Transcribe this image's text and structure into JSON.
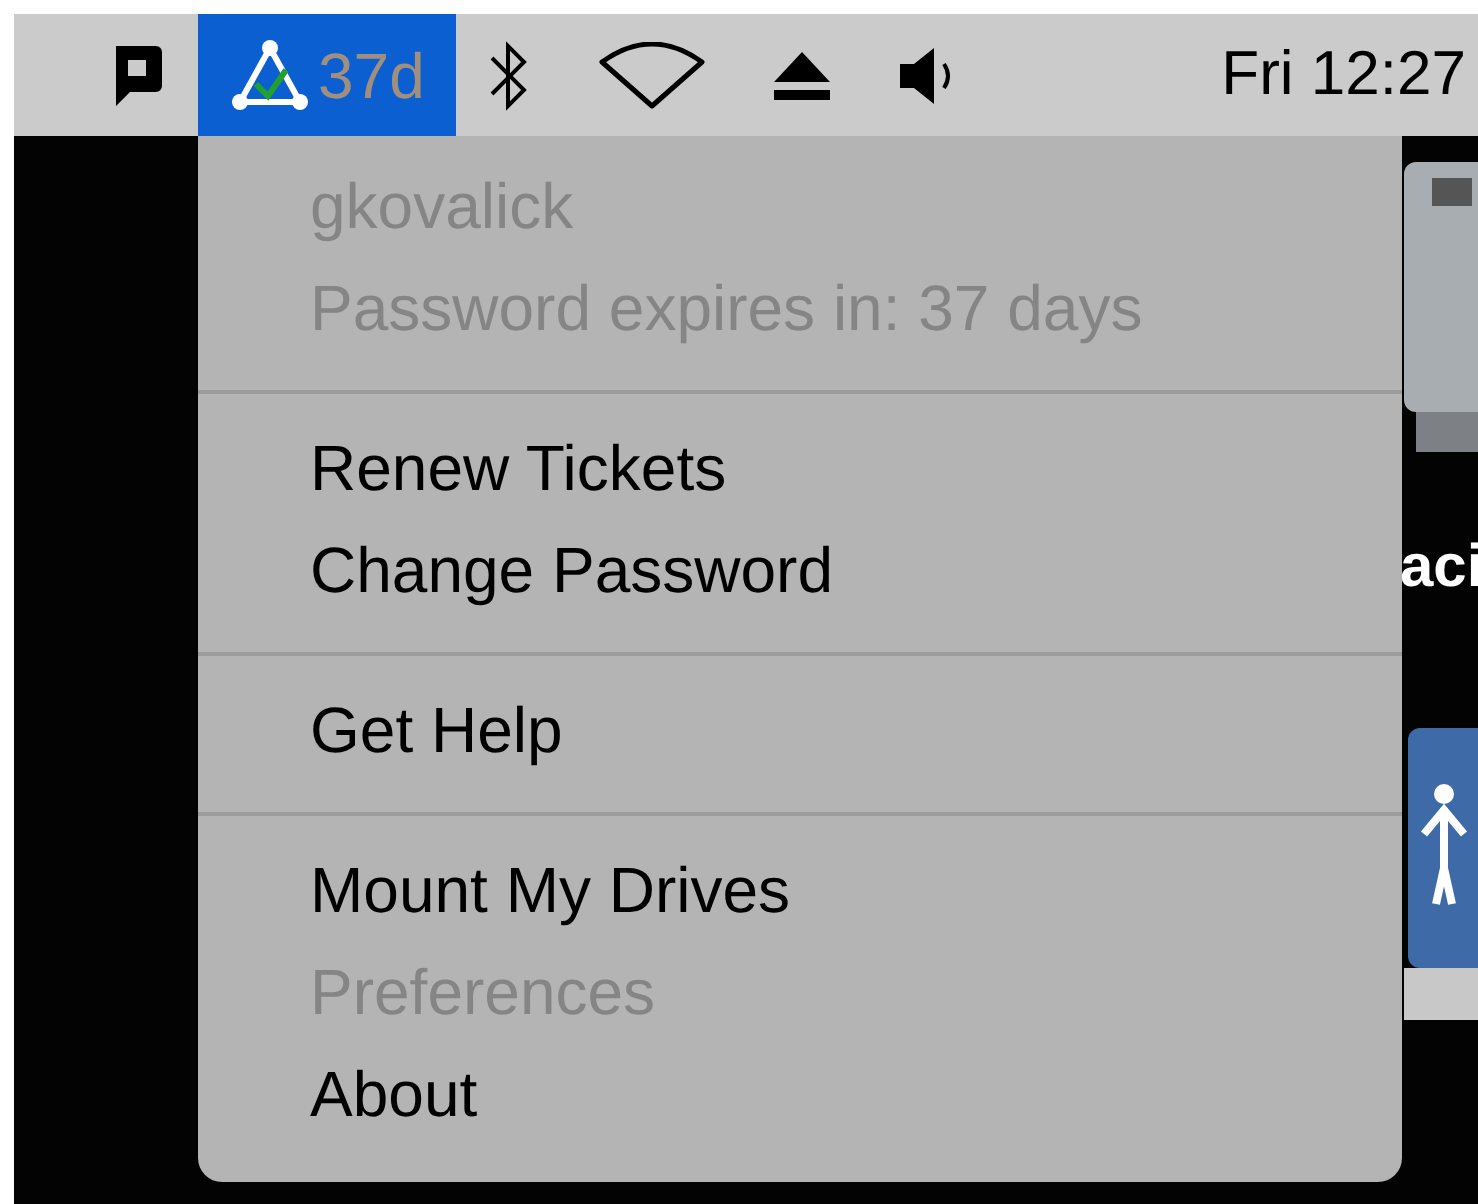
{
  "menu_bar": {
    "items": [
      {
        "kind": "bubble"
      },
      {
        "kind": "extra",
        "label": "37d",
        "selected": true
      },
      {
        "kind": "bluetooth"
      },
      {
        "kind": "wifi"
      },
      {
        "kind": "eject"
      },
      {
        "kind": "volume"
      }
    ],
    "clock": "Fri 12:27"
  },
  "desktop": {
    "items": [
      {
        "kind": "drive"
      },
      {
        "kind": "label",
        "label": "aci"
      },
      {
        "kind": "user"
      }
    ]
  },
  "menu": {
    "sections": [
      {
        "items": [
          {
            "label": "gkovalick",
            "disabled": true
          },
          {
            "label": "Password expires in: 37 days",
            "disabled": true
          }
        ]
      },
      {
        "items": [
          {
            "label": "Renew Tickets",
            "disabled": false
          },
          {
            "label": "Change Password",
            "disabled": false
          }
        ]
      },
      {
        "items": [
          {
            "label": "Get Help",
            "disabled": false
          }
        ]
      },
      {
        "items": [
          {
            "label": "Mount My Drives",
            "disabled": false
          },
          {
            "label": "Preferences",
            "disabled": true
          },
          {
            "label": "About",
            "disabled": false
          }
        ]
      }
    ]
  }
}
